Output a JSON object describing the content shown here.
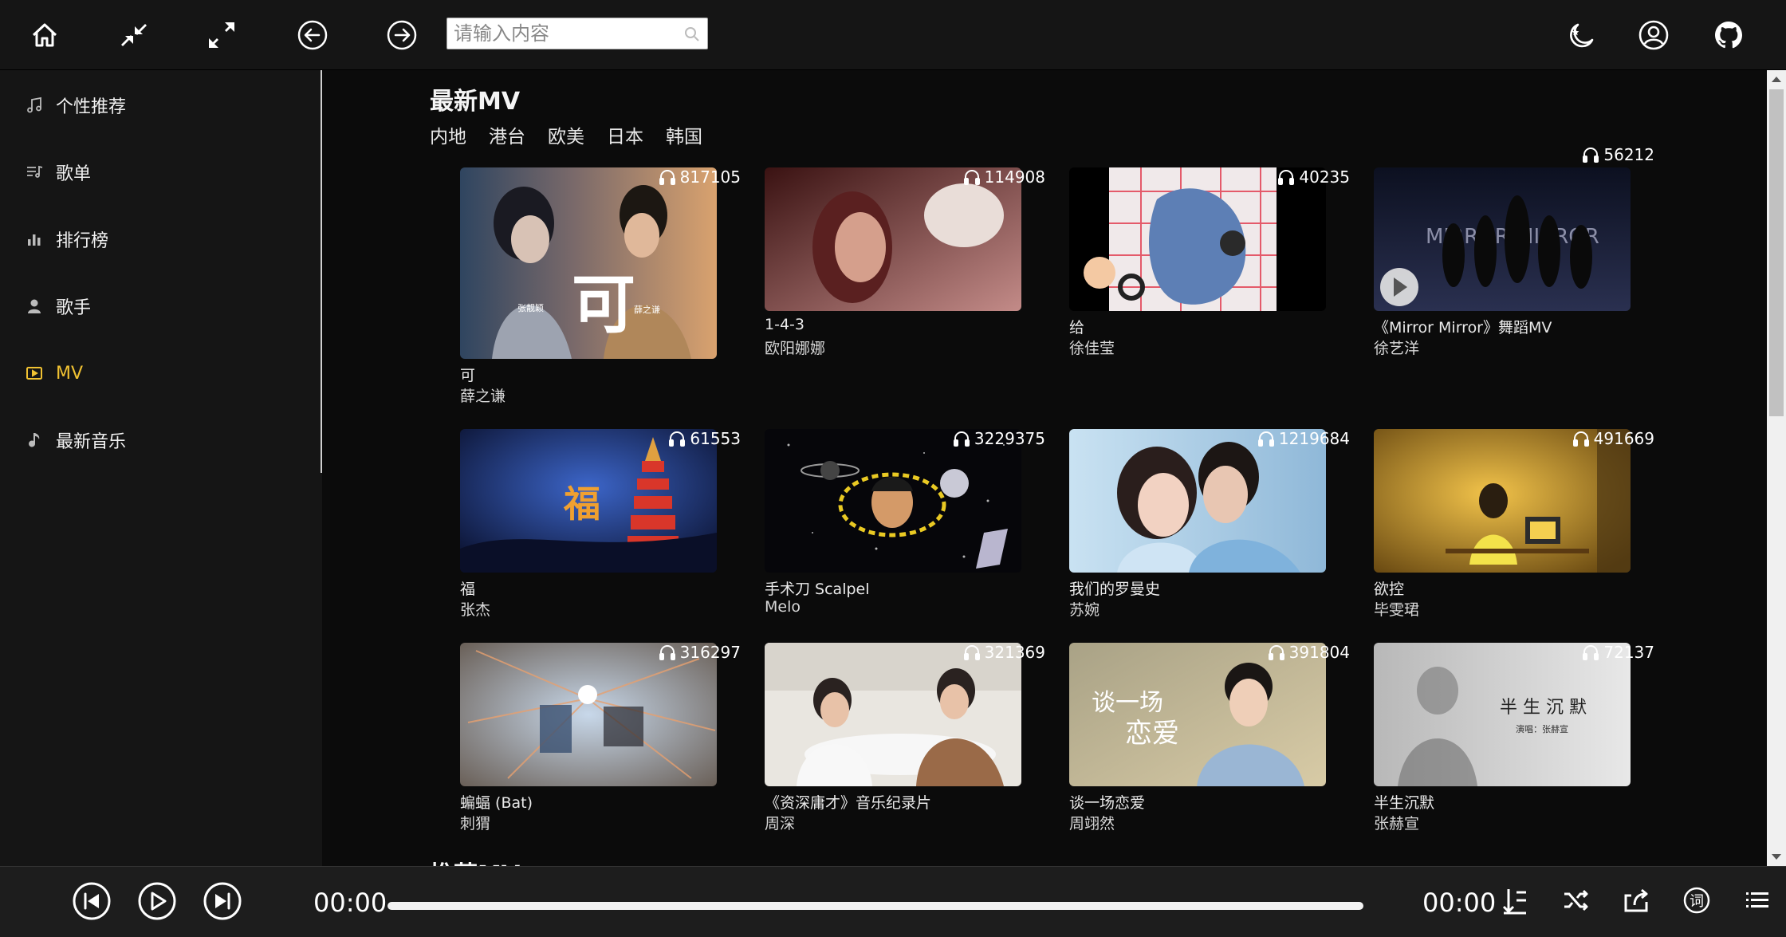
{
  "search": {
    "placeholder": "请输入内容"
  },
  "topbar": {
    "icons": [
      "home-icon",
      "compress-icon",
      "expand-icon",
      "back-arrow-icon",
      "forward-arrow-icon",
      "night-mode-icon",
      "user-icon",
      "github-icon"
    ]
  },
  "sidebar": {
    "items": [
      {
        "label": "个性推荐",
        "icon": "music-note-icon",
        "active": false
      },
      {
        "label": "歌单",
        "icon": "playlist-icon",
        "active": false
      },
      {
        "label": "排行榜",
        "icon": "bar-chart-icon",
        "active": false
      },
      {
        "label": "歌手",
        "icon": "person-icon",
        "active": false
      },
      {
        "label": "MV",
        "icon": "video-icon",
        "active": true
      },
      {
        "label": "最新音乐",
        "icon": "quaver-icon",
        "active": false
      }
    ],
    "active_color": "#f1c232"
  },
  "main": {
    "section_title": "最新MV",
    "tabs": [
      "内地",
      "港台",
      "欧美",
      "日本",
      "韩国"
    ],
    "next_section_title": "推荐MV",
    "mvs": [
      {
        "title": "可",
        "artist": "薛之谦",
        "plays": "817105"
      },
      {
        "title": "1-4-3",
        "artist": "欧阳娜娜",
        "plays": "114908"
      },
      {
        "title": "给",
        "artist": "徐佳莹",
        "plays": "40235"
      },
      {
        "title": "《Mirror Mirror》舞蹈MV",
        "artist": "徐艺洋",
        "plays": "56212"
      },
      {
        "title": "福",
        "artist": "张杰",
        "plays": "61553"
      },
      {
        "title": "手术刀 Scalpel",
        "artist": "Melo",
        "plays": "3229375"
      },
      {
        "title": "我们的罗曼史",
        "artist": "苏婉",
        "plays": "1219684"
      },
      {
        "title": "欲控",
        "artist": "毕雯珺",
        "plays": "491669"
      },
      {
        "title": "蝙蝠 (Bat)",
        "artist": "刺猬",
        "plays": "316297"
      },
      {
        "title": "《资深庸才》音乐纪录片",
        "artist": "周深",
        "plays": "321369"
      },
      {
        "title": "谈一场恋爱",
        "artist": "周翊然",
        "plays": "391804"
      },
      {
        "title": "半生沉默",
        "artist": "张赫宣",
        "plays": "72137"
      }
    ],
    "thumb_text": {
      "ke_big": "可",
      "ke_left_name": "张靓颖",
      "ke_right_name": "薛之谦",
      "mirror": "MIRROR MIRROR",
      "fu": "福",
      "tanyichang_1": "谈一场",
      "tanyichang_2": "恋爱",
      "bansheng_title": "半 生 沉 默",
      "bansheng_sub": "演唱：张赫宣"
    }
  },
  "player": {
    "current_time": "00:00",
    "total_time": "00:00",
    "progress": 0,
    "controls": [
      "previous-track-icon",
      "play-icon",
      "next-track-icon"
    ],
    "right_icons": [
      "playlist-order-icon",
      "shuffle-icon",
      "share-icon",
      "lyrics-icon",
      "menu-icon"
    ],
    "lyrics_glyph": "词"
  }
}
